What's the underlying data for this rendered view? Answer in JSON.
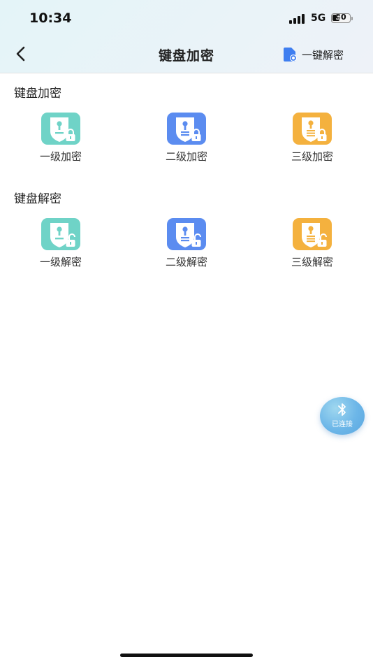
{
  "status_bar": {
    "time": "10:34",
    "network": "5G",
    "battery": "30"
  },
  "header": {
    "title": "键盘加密",
    "one_key_label": "一键解密"
  },
  "sections": [
    {
      "title": "键盘加密",
      "items": [
        {
          "label": "一级加密",
          "color": "#6fd3c7",
          "icon": "shield-lock-icon"
        },
        {
          "label": "二级加密",
          "color": "#5b8cf0",
          "icon": "shield-lock-icon"
        },
        {
          "label": "三级加密",
          "color": "#f4b13e",
          "icon": "shield-lock-icon"
        }
      ]
    },
    {
      "title": "键盘解密",
      "items": [
        {
          "label": "一级解密",
          "color": "#6fd3c7",
          "icon": "shield-unlock-icon"
        },
        {
          "label": "二级解密",
          "color": "#5b8cf0",
          "icon": "shield-unlock-icon"
        },
        {
          "label": "三级解密",
          "color": "#f4b13e",
          "icon": "shield-unlock-icon"
        }
      ]
    }
  ],
  "bluetooth": {
    "label": "已连接",
    "icon": "bluetooth-icon"
  },
  "colors": {
    "accent": "#3f7ef0",
    "badge": "#6cb6e8"
  }
}
